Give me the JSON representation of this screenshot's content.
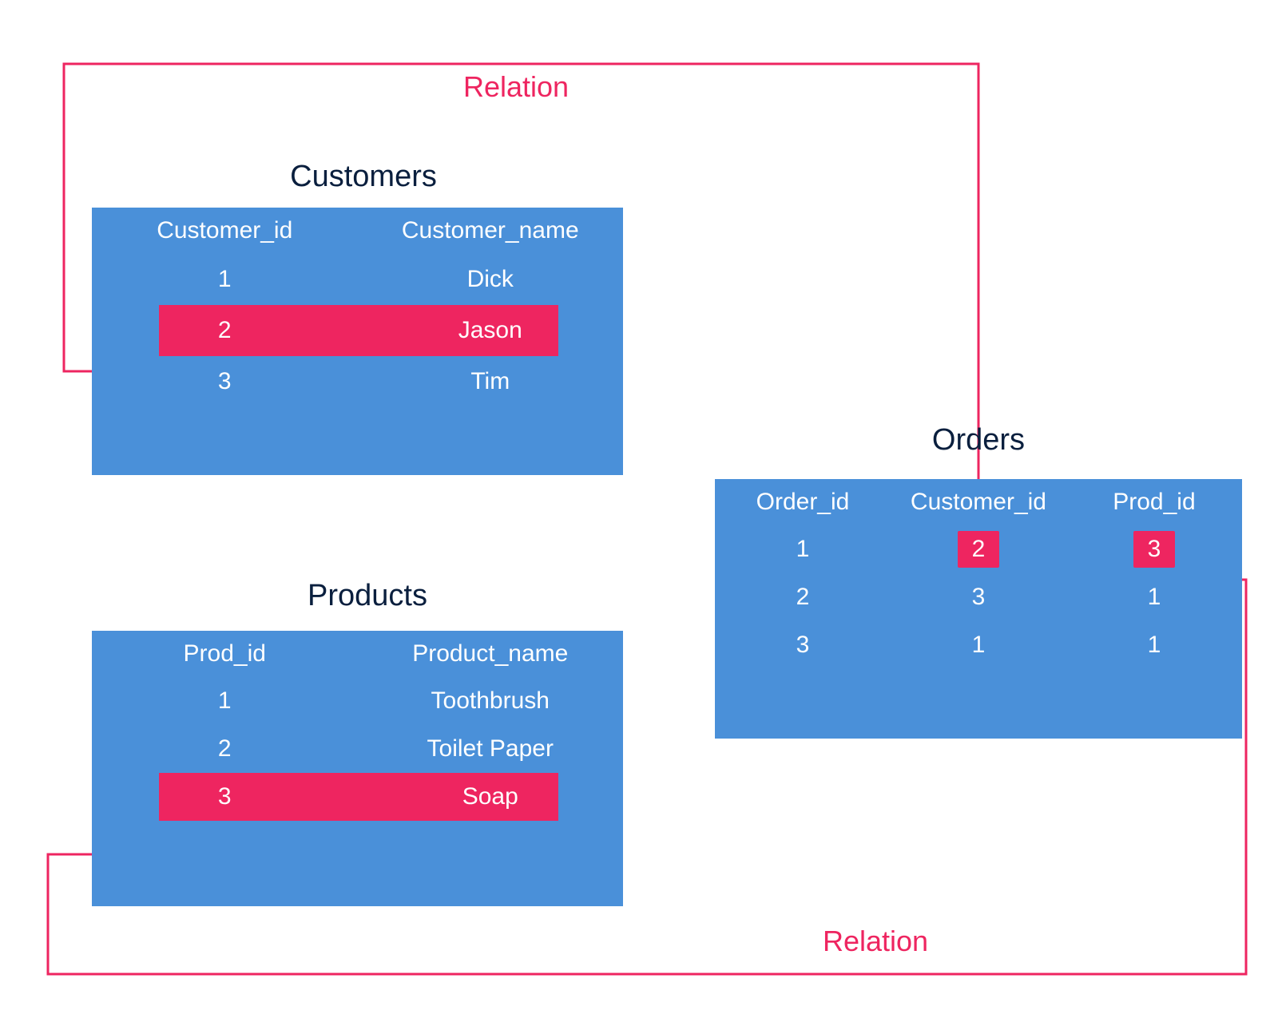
{
  "relation_label_top": "Relation",
  "relation_label_bottom": "Relation",
  "colors": {
    "table_bg": "#4a90d9",
    "highlight": "#ee2560",
    "title": "#0a1f3e",
    "text": "#ffffff"
  },
  "customers": {
    "title": "Customers",
    "headers": [
      "Customer_id",
      "Customer_name"
    ],
    "rows": [
      {
        "id": "1",
        "name": "Dick",
        "highlighted": false
      },
      {
        "id": "2",
        "name": "Jason",
        "highlighted": true
      },
      {
        "id": "3",
        "name": "Tim",
        "highlighted": false
      }
    ]
  },
  "products": {
    "title": "Products",
    "headers": [
      "Prod_id",
      "Product_name"
    ],
    "rows": [
      {
        "id": "1",
        "name": "Toothbrush",
        "highlighted": false
      },
      {
        "id": "2",
        "name": "Toilet Paper",
        "highlighted": false
      },
      {
        "id": "3",
        "name": "Soap",
        "highlighted": true
      }
    ]
  },
  "orders": {
    "title": "Orders",
    "headers": [
      "Order_id",
      "Customer_id",
      "Prod_id"
    ],
    "rows": [
      {
        "order_id": "1",
        "customer_id": "2",
        "prod_id": "3",
        "hl_customer": true,
        "hl_prod": true
      },
      {
        "order_id": "2",
        "customer_id": "3",
        "prod_id": "1",
        "hl_customer": false,
        "hl_prod": false
      },
      {
        "order_id": "3",
        "customer_id": "1",
        "prod_id": "1",
        "hl_customer": false,
        "hl_prod": false
      }
    ]
  }
}
